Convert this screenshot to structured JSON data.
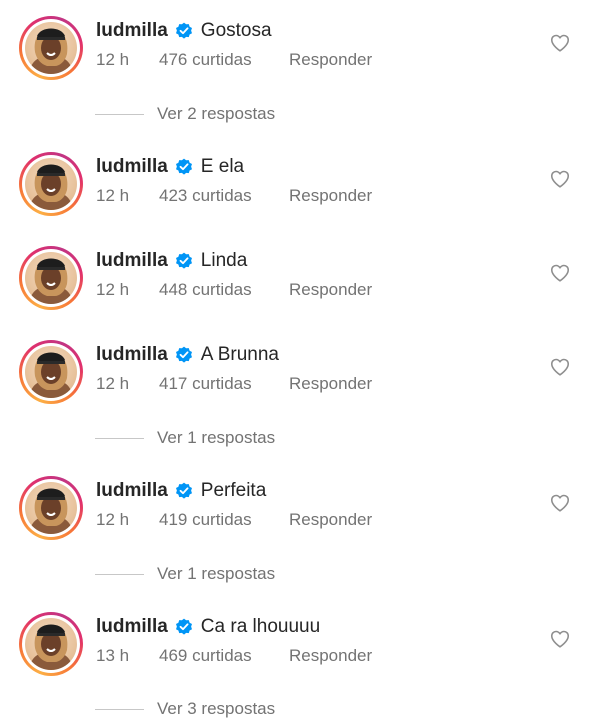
{
  "colors": {
    "text_primary": "#262626",
    "text_secondary": "#737373",
    "verified_blue": "#0095f6",
    "divider": "#c7c7c7"
  },
  "icons": {
    "verified": "verified-badge-icon",
    "like": "heart-outline-icon"
  },
  "comments": [
    {
      "username": "ludmilla",
      "verified": true,
      "text": "Gostosa",
      "time": "12 h",
      "likes": "476 curtidas",
      "reply_label": "Responder",
      "replies_label": "Ver 2 respostas"
    },
    {
      "username": "ludmilla",
      "verified": true,
      "text": "E ela",
      "time": "12 h",
      "likes": "423 curtidas",
      "reply_label": "Responder",
      "replies_label": null
    },
    {
      "username": "ludmilla",
      "verified": true,
      "text": "Linda",
      "time": "12 h",
      "likes": "448 curtidas",
      "reply_label": "Responder",
      "replies_label": null
    },
    {
      "username": "ludmilla",
      "verified": true,
      "text": "A Brunna",
      "time": "12 h",
      "likes": "417 curtidas",
      "reply_label": "Responder",
      "replies_label": "Ver 1 respostas"
    },
    {
      "username": "ludmilla",
      "verified": true,
      "text": "Perfeita",
      "time": "12 h",
      "likes": "419 curtidas",
      "reply_label": "Responder",
      "replies_label": "Ver 1 respostas"
    },
    {
      "username": "ludmilla",
      "verified": true,
      "text": "Ca ra lhouuuu",
      "time": "13 h",
      "likes": "469 curtidas",
      "reply_label": "Responder",
      "replies_label": "Ver 3 respostas"
    }
  ]
}
